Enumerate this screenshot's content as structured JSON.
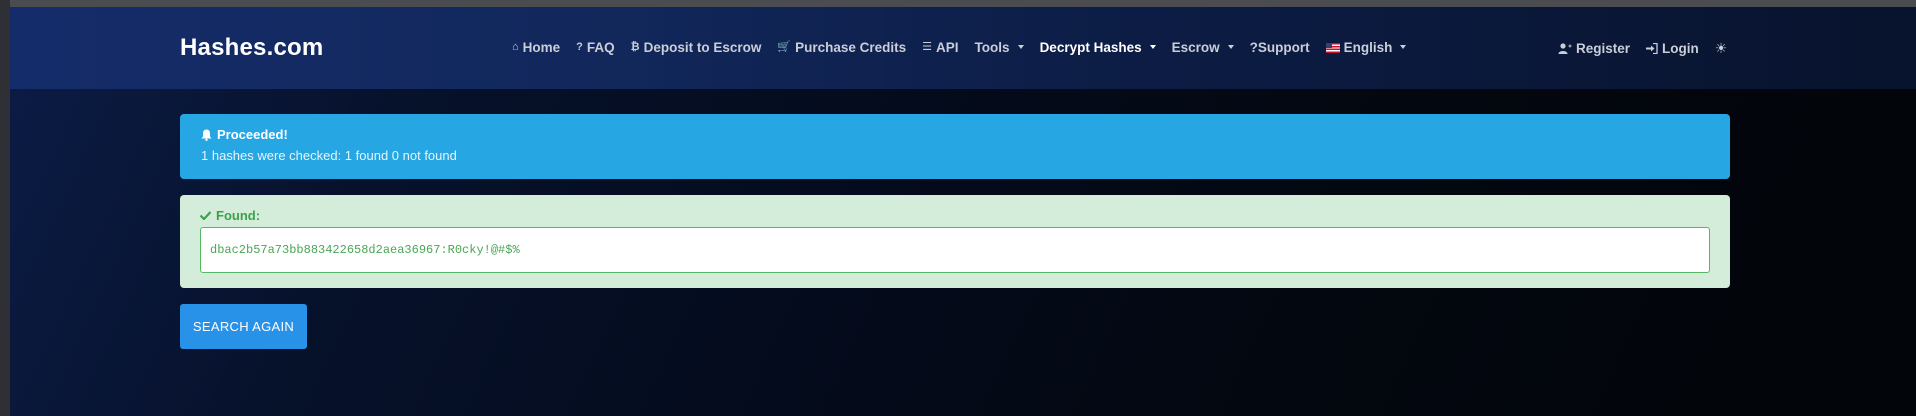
{
  "brand": "Hashes.com",
  "nav": {
    "items": [
      {
        "icon": "⌂",
        "label": "Home"
      },
      {
        "icon": "?",
        "label": "FAQ"
      },
      {
        "icon": "₿",
        "label": "Deposit to Escrow"
      },
      {
        "icon": "🛒",
        "label": "Purchase Credits"
      },
      {
        "icon": "☰",
        "label": "API"
      },
      {
        "icon": "",
        "label": "Tools"
      },
      {
        "icon": "",
        "label": "Decrypt Hashes"
      },
      {
        "icon": "",
        "label": "Escrow"
      },
      {
        "icon": "?",
        "label": "Support"
      },
      {
        "icon": "",
        "label": "English"
      }
    ],
    "register": "Register",
    "login": "Login",
    "theme_icon": "☀"
  },
  "alert": {
    "title": "Proceeded!",
    "message": "1 hashes were checked: 1 found 0 not found"
  },
  "found": {
    "title": "Found:",
    "result": "dbac2b57a73bb883422658d2aea36967:R0cky!@#$%"
  },
  "search_again": "SEARCH AGAIN"
}
